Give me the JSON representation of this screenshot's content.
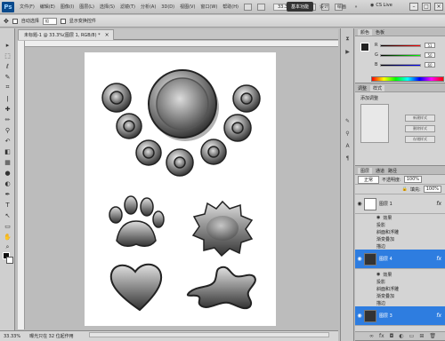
{
  "app": {
    "logo": "Ps",
    "menu": [
      "文件(F)",
      "编辑(E)",
      "图像(I)",
      "图层(L)",
      "选择(S)",
      "滤镜(T)",
      "分析(A)",
      "3D(D)",
      "视图(V)",
      "窗口(W)",
      "帮助(H)"
    ],
    "zoom": "33.3",
    "workspaces": {
      "basic": "基本功能",
      "design": "设计",
      "paint": "绘画"
    },
    "cs_live": "CS Live"
  },
  "options": {
    "auto_select": "自动选择",
    "auto_select_value": "组",
    "transform": "显示变换控件"
  },
  "document": {
    "tab_title": "未标题-1 @ 33.3%(图层 1, RGB/8) *",
    "zoom_status": "33.33%",
    "status_text": "曝光只在 32 位起作用"
  },
  "color_panel": {
    "tabs": [
      "颜色",
      "色板"
    ],
    "r_value": "51",
    "g_value": "50",
    "b_value": "60"
  },
  "styles_panel": {
    "tabs": [
      "调整",
      "样式"
    ],
    "header": "添加调整",
    "buttons": [
      "新建样式",
      "删除样式",
      "存储样式"
    ]
  },
  "layers_panel": {
    "tabs": [
      "图层",
      "通道",
      "路径"
    ],
    "blend_mode": "正常",
    "opacity_label": "不透明度:",
    "opacity": "100%",
    "fill_label": "填充:",
    "fill": "100%",
    "layers": [
      {
        "name": "图层 1",
        "selected": false
      },
      {
        "name": "图层 4",
        "selected": true
      },
      {
        "name": "图层 3",
        "selected": true
      }
    ],
    "effects_label": "效果",
    "effects": [
      "投影",
      "斜面和浮雕",
      "渐变叠加",
      "描边"
    ]
  },
  "colors": {
    "accent": "#2e7de0",
    "dark_ui": "#333333"
  }
}
